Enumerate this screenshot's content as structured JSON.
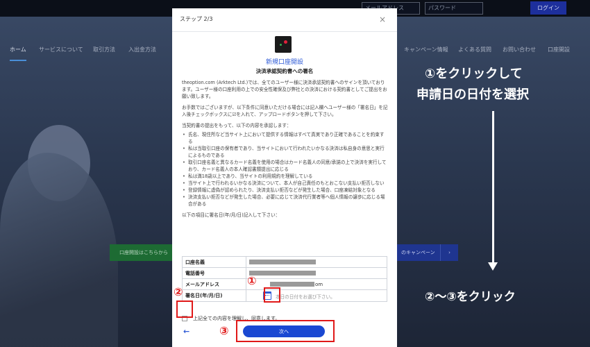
{
  "site": {
    "email_placeholder": "メールアドレス",
    "password_placeholder": "パスワード",
    "login_label": "ログイン",
    "nav": [
      "ホーム",
      "サービスについて",
      "取引方法",
      "入出金方法",
      "キャンペーン情報",
      "よくある質問",
      "お問い合わせ",
      "口座開設"
    ],
    "open_account_btn": "口座開設はこちらから",
    "campaign_btn": "のキャンペーン",
    "campaign_arrow": "›"
  },
  "modal": {
    "step": "ステップ 2/3",
    "close": "×",
    "title": "新規口座開設",
    "subtitle": "決済承認契約書への署名",
    "intro": "theoption.com (Arktech Ltd.)では、全てのユーザー様に決済承認契約書へのサインを頂いております。ユーザー様の口座利用の上での安全性確保及び弊社との決済における契約書としてご提出をお願い致します。",
    "notice": "お手数ではございますが、以下条件に同意いただける場合には記入欄へユーザー様の「署名日」を記入後チェックボックスに☑を入れて、アップロードボタンを押して下さい。",
    "agree_intro": "当契約書の提出をもって、以下の内容を承認します：",
    "terms": [
      "氏名、現住所など当サイト上において提供する情報はすべて真実であり正確であることを約束する",
      "私は当取引口座の保有者であり、当サイトにおいて行われたいかなる決済は私自身の意思と実行によるものである",
      "取引口座名義と異なるカード名義を使用の場合はカード名義人の同意/承諾の上で決済を実行しており、カード名義人の本人確認書類提出に応じる",
      "私は満18歳以上であり、当サイトの利用規約を理解している",
      "当サイト上で行われるいかなる決済について、本人が自己責任のもとおこない支払い拒否しない",
      "登録情報に虚偽が認められたり、決済支払い拒否などが発生した場合、口座凍結対象となる",
      "決済支払い拒否などが発生した場合、必要に応じて決済代行業者等へ個人情報の譲歩に応じる場合がある"
    ],
    "form_intro": "以下の項目に署名日(年/月/日)記入して下さい：",
    "fields": [
      {
        "label": "口座名義"
      },
      {
        "label": "電話番号"
      },
      {
        "label": "メールアドレス",
        "suffix": "om"
      },
      {
        "label": "署名日(年/月/日)",
        "placeholder": "本日の日付をお選び下さい。"
      }
    ],
    "agree_label": "上記全ての内容を理解し、同意します。",
    "next_label": "次へ",
    "back_icon": "←"
  },
  "annotations": {
    "guide_line1": "①をクリックして",
    "guide_line2": "申請日の日付を選択",
    "guide_line3": "②〜③をクリック",
    "num1": "①",
    "num2": "②",
    "num3": "③",
    "color": "#e01818"
  }
}
